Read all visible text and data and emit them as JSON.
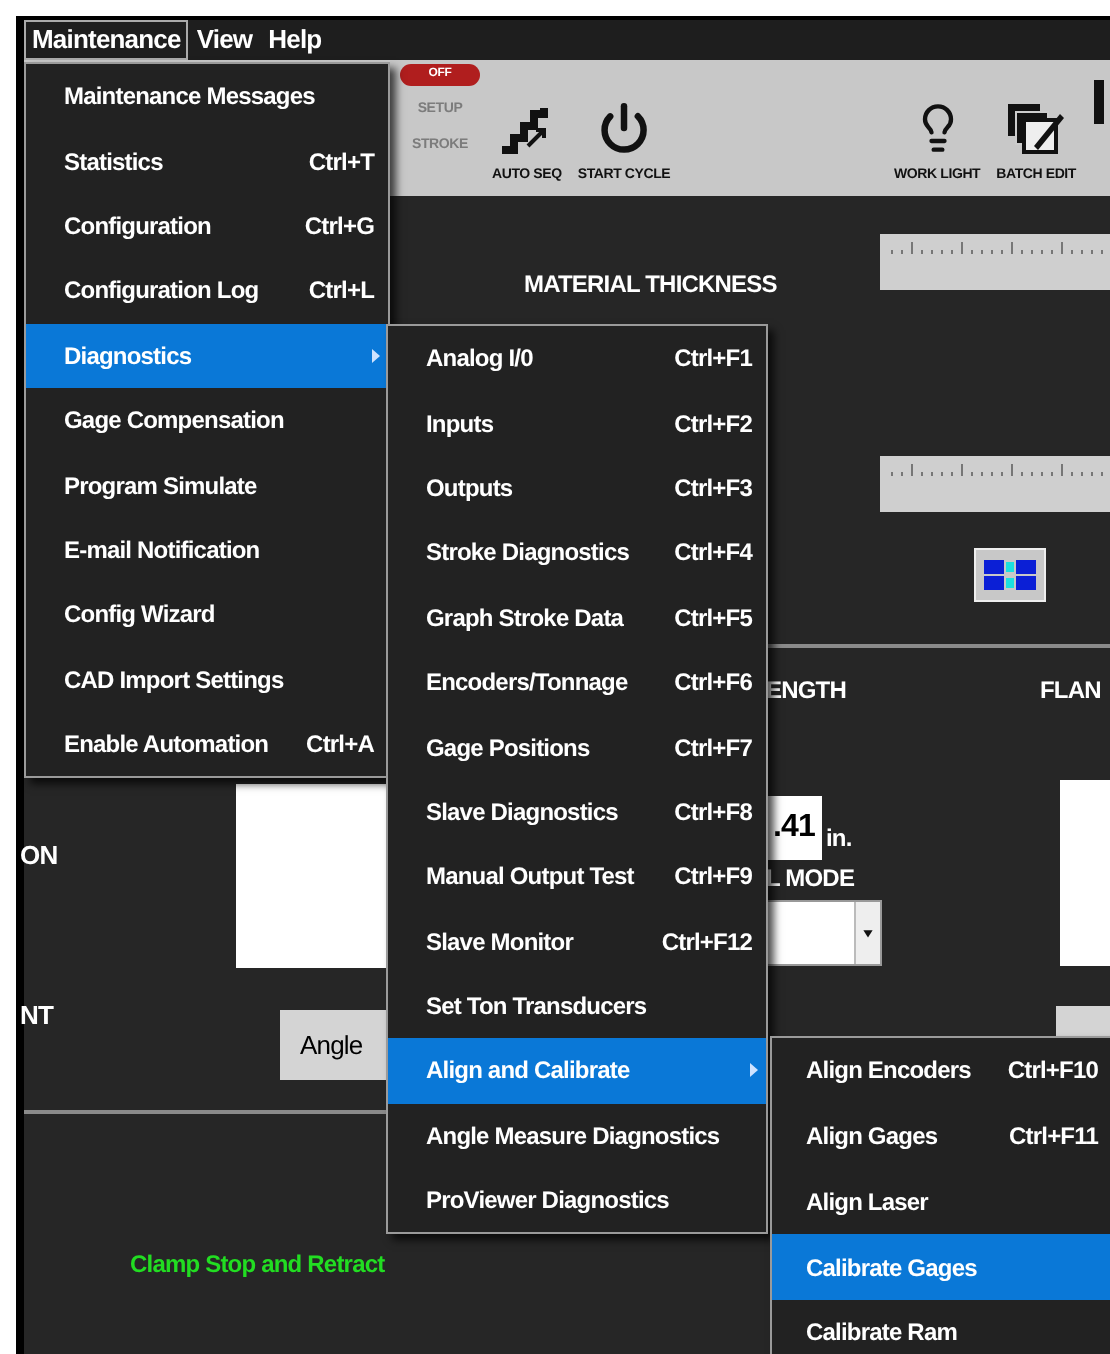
{
  "menu_bar": [
    {
      "label": "Maintenance",
      "selected": true
    },
    {
      "label": "View",
      "selected": false
    },
    {
      "label": "Help",
      "selected": false
    }
  ],
  "toolbar": {
    "mode_switch": {
      "label": "OFF",
      "on": false
    },
    "modes": [
      {
        "label": "SETUP",
        "disabled": true
      },
      {
        "label": "STROKE",
        "disabled": true
      }
    ],
    "buttons": [
      {
        "label": "AUTO SEQ"
      },
      {
        "label": "START CYCLE"
      },
      {
        "label": "WORK LIGHT"
      },
      {
        "label": "BATCH EDIT"
      }
    ]
  },
  "main": {
    "material_thickness_label": "MATERIAL THICKNESS",
    "length_label": "ENGTH",
    "flange_label": "FLAN",
    "length_value": ".41",
    "length_unit": "in.",
    "mode_label": "L MODE",
    "left_label_1": "ON",
    "left_label_2": "NT",
    "angle_button": "Angle",
    "status": "Clamp Stop and Retract"
  },
  "menu": {
    "items": [
      {
        "label": "Maintenance Messages",
        "has_submenu": false,
        "selected": false
      },
      {
        "label": "Statistics",
        "shortcut": "Ctrl+T",
        "has_submenu": false,
        "selected": false
      },
      {
        "label": "Configuration",
        "shortcut": "Ctrl+G",
        "has_submenu": false,
        "selected": false
      },
      {
        "label": "Configuration Log",
        "shortcut": "Ctrl+L",
        "has_submenu": false,
        "selected": false
      },
      {
        "label": "Diagnostics",
        "has_submenu": true,
        "selected": true
      },
      {
        "label": "Gage Compensation",
        "has_submenu": false,
        "selected": false
      },
      {
        "label": "Program Simulate",
        "has_submenu": false,
        "selected": false
      },
      {
        "label": "E-mail Notification",
        "has_submenu": false,
        "selected": false
      },
      {
        "label": "Config Wizard",
        "has_submenu": false,
        "selected": false
      },
      {
        "label": "CAD Import Settings",
        "has_submenu": false,
        "selected": false
      },
      {
        "label": "Enable Automation",
        "shortcut": "Ctrl+A",
        "has_submenu": false,
        "selected": false
      }
    ]
  },
  "diagnostics_menu": {
    "items": [
      {
        "label": "Analog I/0",
        "shortcut": "Ctrl+F1",
        "has_submenu": false,
        "selected": false
      },
      {
        "label": "Inputs",
        "shortcut": "Ctrl+F2",
        "has_submenu": false,
        "selected": false
      },
      {
        "label": "Outputs",
        "shortcut": "Ctrl+F3",
        "has_submenu": false,
        "selected": false
      },
      {
        "label": "Stroke Diagnostics",
        "shortcut": "Ctrl+F4",
        "has_submenu": false,
        "selected": false
      },
      {
        "label": "Graph Stroke Data",
        "shortcut": "Ctrl+F5",
        "has_submenu": false,
        "selected": false
      },
      {
        "label": "Encoders/Tonnage",
        "shortcut": "Ctrl+F6",
        "has_submenu": false,
        "selected": false
      },
      {
        "label": "Gage Positions",
        "shortcut": "Ctrl+F7",
        "has_submenu": false,
        "selected": false
      },
      {
        "label": "Slave Diagnostics",
        "shortcut": "Ctrl+F8",
        "has_submenu": false,
        "selected": false
      },
      {
        "label": "Manual Output Test",
        "shortcut": "Ctrl+F9",
        "has_submenu": false,
        "selected": false
      },
      {
        "label": "Slave Monitor",
        "shortcut": "Ctrl+F12",
        "has_submenu": false,
        "selected": false
      },
      {
        "label": "Set Ton Transducers",
        "has_submenu": false,
        "selected": false
      },
      {
        "label": "Align and Calibrate",
        "has_submenu": true,
        "selected": true
      },
      {
        "label": "Angle Measure Diagnostics",
        "has_submenu": false,
        "selected": false
      },
      {
        "label": "ProViewer Diagnostics",
        "has_submenu": false,
        "selected": false
      }
    ]
  },
  "align_menu": {
    "items": [
      {
        "label": "Align Encoders",
        "shortcut": "Ctrl+F10",
        "selected": false
      },
      {
        "label": "Align Gages",
        "shortcut": "Ctrl+F11",
        "selected": false
      },
      {
        "label": "Align Laser",
        "selected": false
      },
      {
        "label": "Calibrate Gages",
        "selected": true
      },
      {
        "label": "Calibrate Ram",
        "selected": false
      }
    ]
  }
}
